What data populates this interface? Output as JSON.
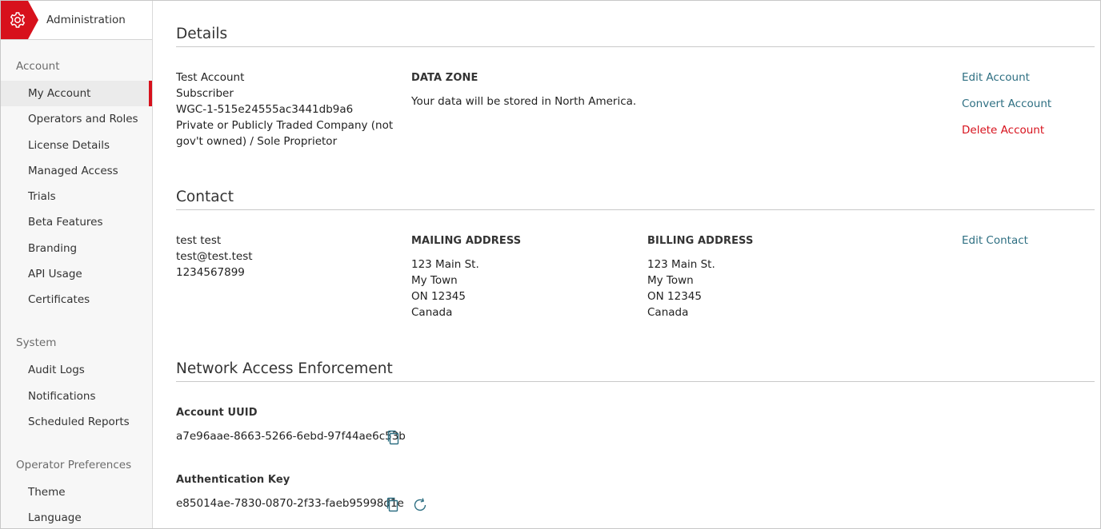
{
  "sidebar": {
    "title": "Administration",
    "groups": [
      {
        "label": "Account",
        "items": [
          "My Account",
          "Operators and Roles",
          "License Details",
          "Managed Access",
          "Trials",
          "Beta Features",
          "Branding",
          "API Usage",
          "Certificates"
        ]
      },
      {
        "label": "System",
        "items": [
          "Audit Logs",
          "Notifications",
          "Scheduled Reports"
        ]
      },
      {
        "label": "Operator Preferences",
        "items": [
          "Theme",
          "Language"
        ]
      }
    ],
    "active_item": "My Account"
  },
  "details": {
    "title": "Details",
    "account_name": "Test Account",
    "account_type": "Subscriber",
    "account_id": "WGC-1-515e24555ac3441db9a6",
    "company_type_line1": "Private or Publicly Traded Company (not",
    "company_type_line2": "gov't owned) / Sole Proprietor",
    "data_zone_label": "DATA ZONE",
    "data_zone_text": "Your data will be stored in North America.",
    "edit_account": "Edit Account",
    "convert_account": "Convert Account",
    "delete_account": "Delete Account"
  },
  "contact": {
    "title": "Contact",
    "name": "test test",
    "email": "test@test.test",
    "phone": "1234567899",
    "mailing_label": "MAILING ADDRESS",
    "mailing": [
      "123 Main St.",
      "My Town",
      "ON 12345",
      "Canada"
    ],
    "billing_label": "BILLING ADDRESS",
    "billing": [
      "123 Main St.",
      "My Town",
      "ON 12345",
      "Canada"
    ],
    "edit_contact": "Edit Contact"
  },
  "network": {
    "title": "Network Access Enforcement",
    "uuid_label": "Account UUID",
    "uuid_value": "a7e96aae-8663-5266-6ebd-97f44ae6c53b",
    "auth_label": "Authentication Key",
    "auth_value": "e85014ae-7830-0870-2f33-faeb95998d1e"
  },
  "icons": {
    "gear": "gear-icon",
    "copy": "copy-icon",
    "refresh": "refresh-icon"
  },
  "colors": {
    "brand_red": "#d7111c",
    "link": "#2e6f82",
    "danger": "#d7111c"
  }
}
